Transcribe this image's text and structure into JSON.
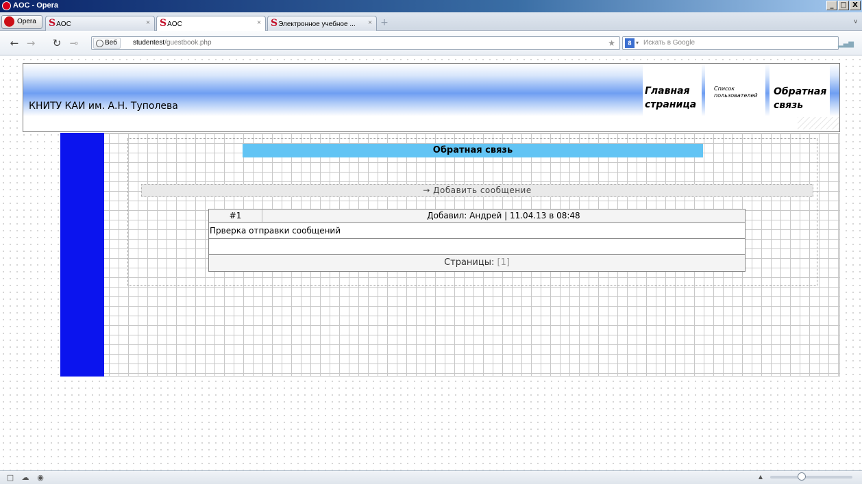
{
  "window": {
    "title": "AOC - Opera",
    "controls": [
      "_",
      "□",
      "X"
    ]
  },
  "browser": {
    "menu_label": "Opera",
    "tabs": [
      {
        "label": "AOC",
        "active": false
      },
      {
        "label": "AOC",
        "active": true
      },
      {
        "label": "Электронное учебное ...",
        "active": false
      }
    ],
    "address": {
      "web_label": "Веб",
      "host": "studentest",
      "path": "/guestbook.php"
    },
    "search_placeholder": "Искать в Google"
  },
  "page": {
    "site_title": "КНИТУ КАИ им. А.Н. Туполева",
    "nav": {
      "home": "Главная страница",
      "users": "Список пользователей",
      "feedback": "Обратная связь"
    },
    "section_title": "Обратная связь",
    "add_message": "→ Добавить сообщение",
    "messages": [
      {
        "number": "#1",
        "meta": "Добавил: Андрей | 11.04.13 в 08:48",
        "text": "Прверка отправки сообщений"
      }
    ],
    "pages_label": "Страницы:",
    "pages": "[1]"
  },
  "colors": {
    "sidebar": "#0b14ee",
    "title_bar": "#62c4f4",
    "brand": "#c4122c"
  }
}
